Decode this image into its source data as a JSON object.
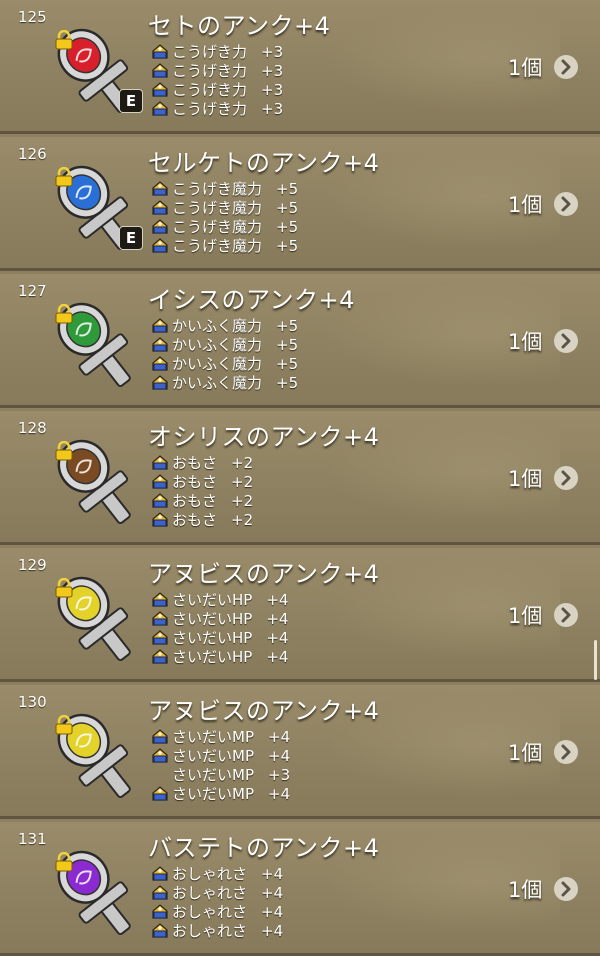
{
  "items": [
    {
      "number": "125",
      "name": "セトのアンク+4",
      "gem_color": "#d8202c",
      "equipped_badge": "E",
      "quantity": "1個",
      "stats": [
        {
          "label": "こうげき力",
          "value": "+3",
          "has_icon": true
        },
        {
          "label": "こうげき力",
          "value": "+3",
          "has_icon": true
        },
        {
          "label": "こうげき力",
          "value": "+3",
          "has_icon": true
        },
        {
          "label": "こうげき力",
          "value": "+3",
          "has_icon": true
        }
      ]
    },
    {
      "number": "126",
      "name": "セルケトのアンク+4",
      "gem_color": "#2a6fd6",
      "equipped_badge": "E",
      "quantity": "1個",
      "stats": [
        {
          "label": "こうげき魔力",
          "value": "+5",
          "has_icon": true
        },
        {
          "label": "こうげき魔力",
          "value": "+5",
          "has_icon": true
        },
        {
          "label": "こうげき魔力",
          "value": "+5",
          "has_icon": true
        },
        {
          "label": "こうげき魔力",
          "value": "+5",
          "has_icon": true
        }
      ]
    },
    {
      "number": "127",
      "name": "イシスのアンク+4",
      "gem_color": "#2f9a3a",
      "equipped_badge": "",
      "quantity": "1個",
      "stats": [
        {
          "label": "かいふく魔力",
          "value": "+5",
          "has_icon": true
        },
        {
          "label": "かいふく魔力",
          "value": "+5",
          "has_icon": true
        },
        {
          "label": "かいふく魔力",
          "value": "+5",
          "has_icon": true
        },
        {
          "label": "かいふく魔力",
          "value": "+5",
          "has_icon": true
        }
      ]
    },
    {
      "number": "128",
      "name": "オシリスのアンク+4",
      "gem_color": "#7a4a22",
      "equipped_badge": "",
      "quantity": "1個",
      "stats": [
        {
          "label": "おもさ",
          "value": "+2",
          "has_icon": true
        },
        {
          "label": "おもさ",
          "value": "+2",
          "has_icon": true
        },
        {
          "label": "おもさ",
          "value": "+2",
          "has_icon": true
        },
        {
          "label": "おもさ",
          "value": "+2",
          "has_icon": true
        }
      ]
    },
    {
      "number": "129",
      "name": "アヌビスのアンク+4",
      "gem_color": "#e3d22a",
      "equipped_badge": "",
      "quantity": "1個",
      "stats": [
        {
          "label": "さいだいHP",
          "value": "+4",
          "has_icon": true
        },
        {
          "label": "さいだいHP",
          "value": "+4",
          "has_icon": true
        },
        {
          "label": "さいだいHP",
          "value": "+4",
          "has_icon": true
        },
        {
          "label": "さいだいHP",
          "value": "+4",
          "has_icon": true
        }
      ]
    },
    {
      "number": "130",
      "name": "アヌビスのアンク+4",
      "gem_color": "#e3d22a",
      "equipped_badge": "",
      "quantity": "1個",
      "stats": [
        {
          "label": "さいだいMP",
          "value": "+4",
          "has_icon": true
        },
        {
          "label": "さいだいMP",
          "value": "+4",
          "has_icon": true
        },
        {
          "label": "さいだいMP",
          "value": "+3",
          "has_icon": false
        },
        {
          "label": "さいだいMP",
          "value": "+4",
          "has_icon": true
        }
      ]
    },
    {
      "number": "131",
      "name": "バステトのアンク+4",
      "gem_color": "#8a2ad0",
      "equipped_badge": "",
      "quantity": "1個",
      "stats": [
        {
          "label": "おしゃれさ",
          "value": "+4",
          "has_icon": true
        },
        {
          "label": "おしゃれさ",
          "value": "+4",
          "has_icon": true
        },
        {
          "label": "おしゃれさ",
          "value": "+4",
          "has_icon": true
        },
        {
          "label": "おしゃれさ",
          "value": "+4",
          "has_icon": true
        }
      ]
    }
  ]
}
